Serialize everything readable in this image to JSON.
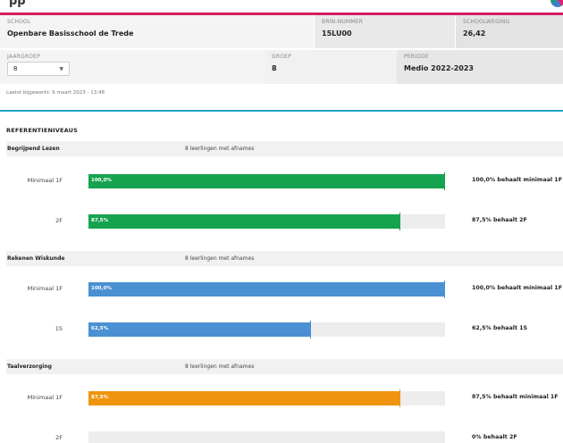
{
  "header": {
    "school_label": "SCHOOL",
    "school_value": "Openbare Basisschool de Trede",
    "brin_label": "BRIN-NUMMER",
    "brin_value": "15LU00",
    "weging_label": "SCHOOLWEGING",
    "weging_value": "26,42",
    "jaargroep_label": "JAARGROEP",
    "jaargroep_value": "8",
    "groep_label": "GROEP",
    "groep_value": "8",
    "periode_label": "PERIODE",
    "periode_value": "Medio 2022-2023"
  },
  "updated": "Laatst bijgewerkt: 6 maart 2023 - 13:48",
  "section_title": "REFERENTIENIVEAUS",
  "colors": {
    "green": "#16a350",
    "blue": "#4a90d2",
    "orange": "#f0940e",
    "pink": "#d81b60",
    "cyan": "#1fa2c9"
  },
  "subjects": [
    {
      "name": "Begrijpend Lezen",
      "count": "8 leerlingen met afnames",
      "levels": [
        {
          "label": "Minimaal 1F",
          "percent": 100,
          "pct_text": "100,0%",
          "desc": "100,0% behaalt minimaal 1F"
        },
        {
          "label": "2F",
          "percent": 87.5,
          "pct_text": "87,5%",
          "desc": "87,5% behaalt 2F"
        }
      ]
    },
    {
      "name": "Rekenen Wiskunde",
      "count": "8 leerlingen met afnames",
      "levels": [
        {
          "label": "Minimaal 1F",
          "percent": 100,
          "pct_text": "100,0%",
          "desc": "100,0% behaalt minimaal 1F"
        },
        {
          "label": "1S",
          "percent": 62.5,
          "pct_text": "62,5%",
          "desc": "62,5% behaalt 1S"
        }
      ]
    },
    {
      "name": "Taalverzorging",
      "count": "8 leerlingen met afnames",
      "levels": [
        {
          "label": "Minimaal 1F",
          "percent": 87.5,
          "pct_text": "87,5%",
          "desc": "87,5% behaalt minimaal 1F"
        },
        {
          "label": "2F",
          "percent": 0,
          "pct_text": "",
          "desc": "0% behaalt 2F"
        }
      ]
    }
  ]
}
